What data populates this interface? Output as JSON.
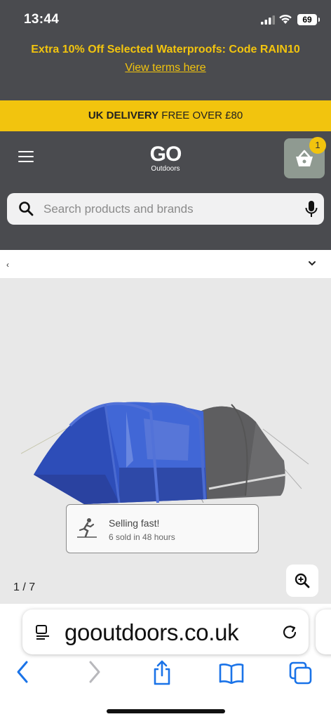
{
  "status_bar": {
    "time": "13:44",
    "battery": "69"
  },
  "promo": {
    "text": "Extra 10% Off Selected Waterproofs: Code RAIN10",
    "link": "View terms here",
    "color": "#f2c40e"
  },
  "delivery": {
    "bold": "UK DELIVERY",
    "rest": " FREE OVER £80"
  },
  "header": {
    "logo_main": "GO",
    "logo_sub": "Outdoors",
    "basket_count": "1"
  },
  "search": {
    "placeholder": "Search products and brands"
  },
  "product": {
    "back": "‹",
    "selling_title": "Selling fast!",
    "selling_sub": "6 sold in 48 hours",
    "counter": "1 / 7"
  },
  "browser": {
    "url": "gooutdoors.co.uk"
  },
  "icons": {
    "menu": "menu-icon",
    "basket": "basket-icon",
    "search": "search-icon",
    "mic": "mic-icon",
    "zoom": "zoom-in-icon",
    "reader": "reader-icon",
    "reload": "reload-icon",
    "back": "back-arrow-icon",
    "forward": "forward-arrow-icon",
    "share": "share-icon",
    "bookmarks": "bookmarks-icon",
    "tabs": "tabs-icon"
  }
}
